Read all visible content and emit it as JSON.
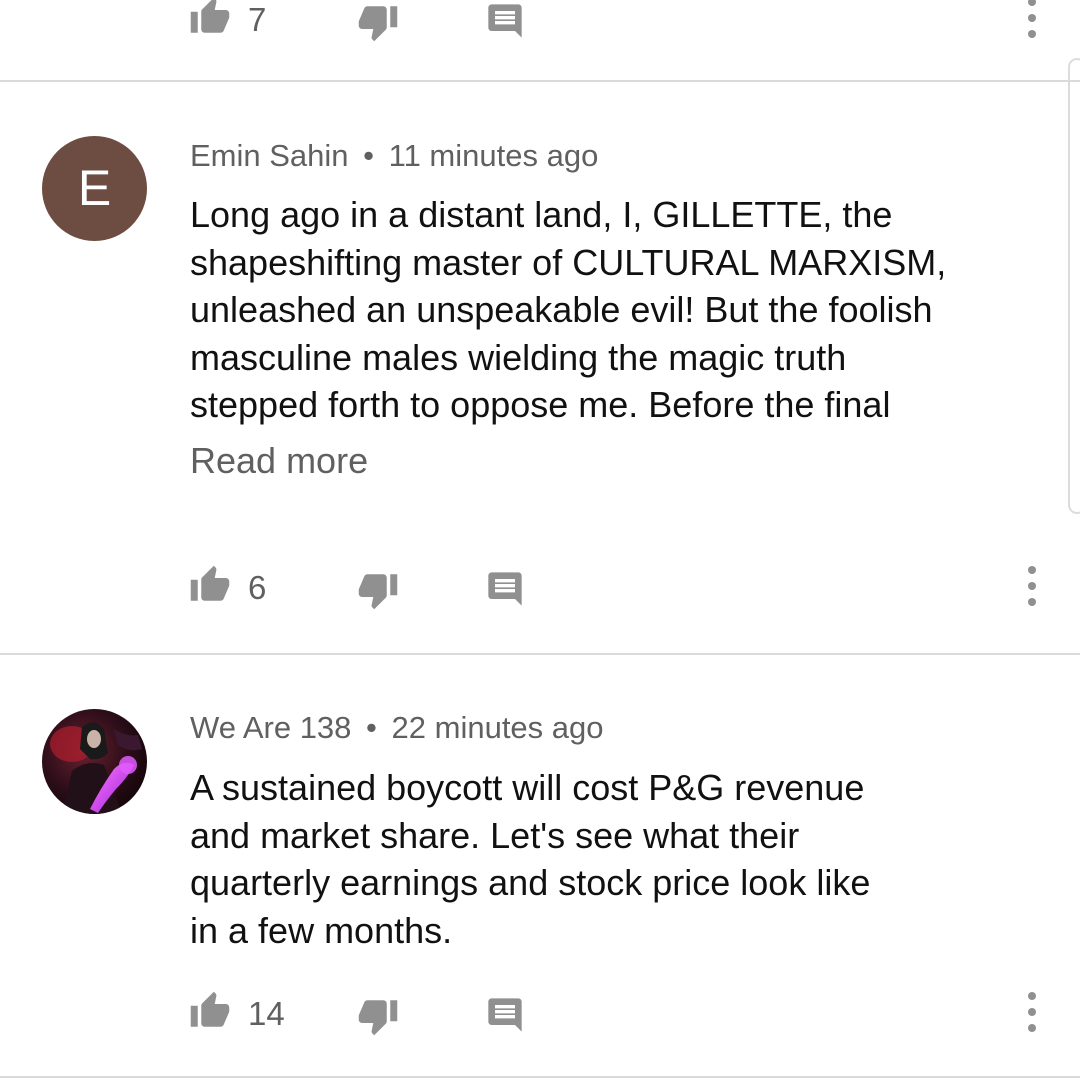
{
  "colors": {
    "icon": "#909090",
    "meta_text": "#606060",
    "body_text": "#111111",
    "divider": "#dadada",
    "avatar_e": "#6d4c41"
  },
  "icons": [
    "thumb-up-icon",
    "thumb-down-icon",
    "reply-icon",
    "more-vert-icon"
  ],
  "top_comment": {
    "like_count": "7"
  },
  "comments": [
    {
      "avatar_letter": "E",
      "author": "Emin Sahin",
      "separator": "•",
      "time": "11 minutes ago",
      "text": "Long ago in a distant land, I, GILLETTE, the\nshapeshifting master of CULTURAL MARXISM,\nunleashed an unspeakable evil! But the foolish\nmasculine males  wielding the magic truth\nstepped forth to oppose me. Before the final",
      "read_more": "Read more",
      "like_count": "6"
    },
    {
      "avatar_letter": "",
      "author": "We Are 138",
      "separator": "•",
      "time": "22 minutes ago",
      "text": "A sustained boycott will cost P&G revenue\nand market share. Let's see what their\nquarterly earnings and stock price look like\nin a few months.",
      "like_count": "14"
    }
  ]
}
